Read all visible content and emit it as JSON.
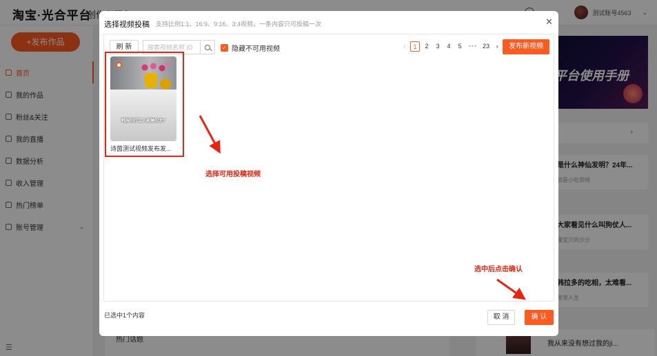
{
  "app": {
    "logo": "淘宝·光合平台",
    "top_menu": "创作者服务",
    "user_name": "测试账号4563",
    "publish_button": "+发布作品"
  },
  "sidebar": {
    "items": [
      {
        "label": "首页",
        "icon": "home-icon",
        "active": true
      },
      {
        "label": "我的作品",
        "icon": "works-icon"
      },
      {
        "label": "粉丝&关注",
        "icon": "fans-icon"
      },
      {
        "label": "我的直播",
        "icon": "live-icon"
      },
      {
        "label": "数据分析",
        "icon": "chart-icon"
      },
      {
        "label": "收入管理",
        "icon": "income-icon"
      },
      {
        "label": "热门榜单",
        "icon": "hot-icon"
      },
      {
        "label": "账号管理",
        "icon": "user-icon",
        "chevron": "⌄"
      }
    ]
  },
  "right_panel": {
    "banner_text": "平台使用手册",
    "items": [
      {
        "title": "是什么神仙发明？24年...",
        "author": "就是小吃货呀"
      },
      {
        "title": "大家看见什么叫狗仗人...",
        "author": "漫宝贝的沙沙"
      },
      {
        "title": "韩拉多的吃相，太难看...",
        "author": "宠宠人生"
      }
    ],
    "bottom_item": "我从来没有想过我的ji..."
  },
  "background_bottom": {
    "label": "热门话题"
  },
  "modal": {
    "title": "选择视频投稿",
    "subtitle": "支持比例1:1、16:9、9:16、3:4视频，一条内容只可投稿一次",
    "refresh_label": "刷 新",
    "search_placeholder": "搜索视频名称 ID",
    "hide_unavailable_label": "隐藏不可用视频",
    "pagination": {
      "current": "1",
      "pages": [
        "2",
        "3",
        "4",
        "5"
      ],
      "ellipsis": "•••",
      "last": "23"
    },
    "new_video_label": "发布新视频",
    "video": {
      "title": "诗茵测试视频发布发...",
      "caption": "韩国的打工人能睡的太?"
    },
    "annotation_select": "选择可用投稿视频",
    "annotation_confirm": "选中后点击确认",
    "selected_count": "已选中1个内容",
    "cancel_label": "取 消",
    "confirm_label": "确 认"
  },
  "colors": {
    "brand": "#ff5a1f",
    "annotation": "#e8230f"
  }
}
